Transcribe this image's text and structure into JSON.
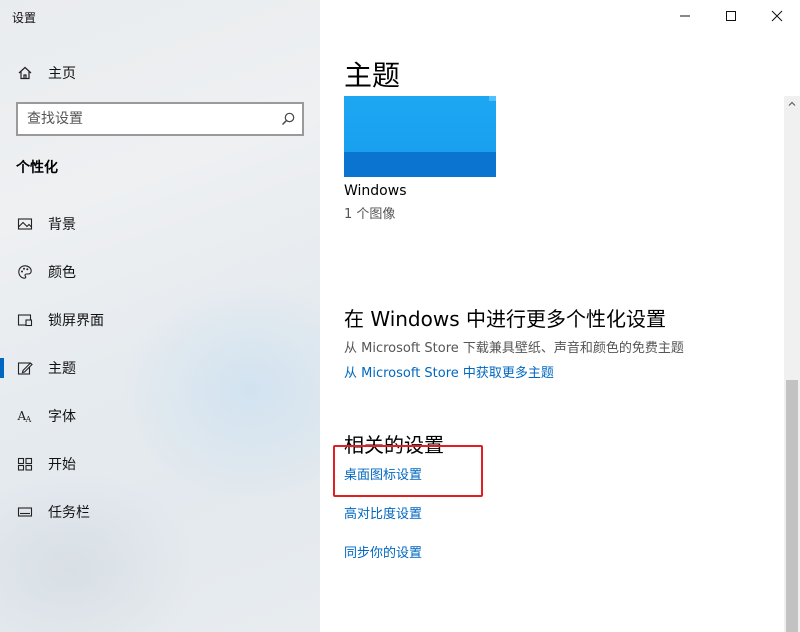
{
  "window": {
    "title": "设置"
  },
  "sidebar": {
    "home_label": "主页",
    "search_placeholder": "查找设置",
    "section_title": "个性化",
    "items": [
      {
        "label": "背景",
        "icon": "image-icon"
      },
      {
        "label": "颜色",
        "icon": "palette-icon"
      },
      {
        "label": "锁屏界面",
        "icon": "lock-screen-icon"
      },
      {
        "label": "主题",
        "icon": "theme-edit-icon",
        "active": true
      },
      {
        "label": "字体",
        "icon": "font-icon"
      },
      {
        "label": "开始",
        "icon": "start-grid-icon"
      },
      {
        "label": "任务栏",
        "icon": "taskbar-icon"
      }
    ]
  },
  "main": {
    "title": "主题",
    "theme": {
      "name": "Windows",
      "count": "1 个图像"
    },
    "more": {
      "heading": "在 Windows 中进行更多个性化设置",
      "description": "从 Microsoft Store 下载兼具壁纸、声音和颜色的免费主题",
      "link": "从 Microsoft Store 中获取更多主题"
    },
    "related": {
      "heading": "相关的设置",
      "links": [
        "桌面图标设置",
        "高对比度设置",
        "同步你的设置"
      ]
    }
  },
  "colors": {
    "accent": "#0067c0",
    "highlight": "#e02020",
    "theme_blue": "#1da7f3"
  }
}
